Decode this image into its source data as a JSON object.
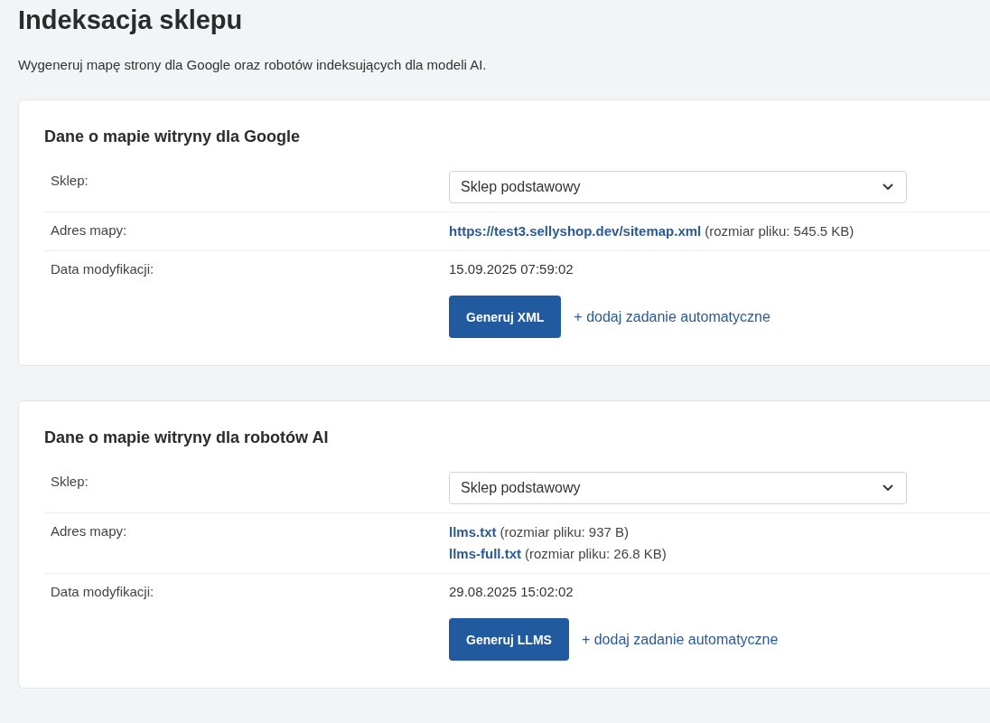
{
  "page": {
    "title": "Indeksacja sklepu",
    "subtitle": "Wygeneruj mapę strony dla Google oraz robotów indeksujących dla modeli AI."
  },
  "sections": [
    {
      "title": "Dane o mapie witryny dla Google",
      "rows": [
        {
          "kind": "select",
          "label": "Sklep:",
          "value": "Sklep podstawowy"
        },
        {
          "kind": "links",
          "label": "Adres mapy:",
          "files": [
            {
              "link": "https://test3.sellyshop.dev/sitemap.xml",
              "size": "(rozmiar pliku: 545.5 KB)"
            }
          ]
        },
        {
          "kind": "text",
          "label": "Data modyfikacji:",
          "value": "15.09.2025 07:59:02"
        }
      ],
      "button": "Generuj XML",
      "auto_link": "+ dodaj zadanie automatyczne"
    },
    {
      "title": "Dane o mapie witryny dla robotów AI",
      "rows": [
        {
          "kind": "select",
          "label": "Sklep:",
          "value": "Sklep podstawowy"
        },
        {
          "kind": "links",
          "label": "Adres mapy:",
          "files": [
            {
              "link": "llms.txt",
              "size": "(rozmiar pliku: 937 B)"
            },
            {
              "link": "llms-full.txt",
              "size": "(rozmiar pliku: 26.8 KB)"
            }
          ]
        },
        {
          "kind": "text",
          "label": "Data modyfikacji:",
          "value": "29.08.2025 15:02:02"
        }
      ],
      "button": "Generuj LLMS",
      "auto_link": "+ dodaj zadanie automatyczne"
    }
  ]
}
